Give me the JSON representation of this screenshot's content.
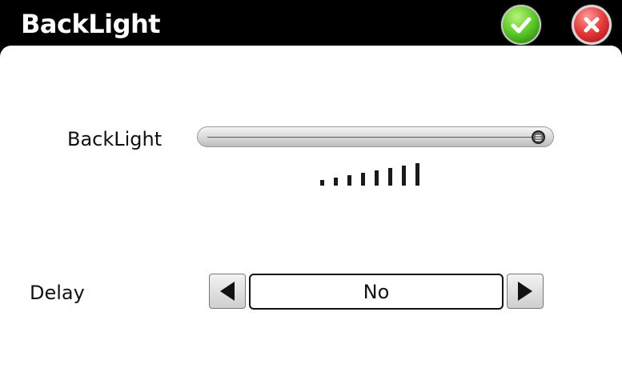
{
  "window": {
    "title": "BackLight"
  },
  "titlebar": {
    "ok_icon": "checkmark-icon",
    "close_icon": "close-icon"
  },
  "backlight": {
    "label": "BackLight",
    "level": 1.0,
    "bars": 8
  },
  "delay": {
    "label": "Delay",
    "value": "No",
    "prev_icon": "left-arrow-icon",
    "next_icon": "right-arrow-icon"
  }
}
